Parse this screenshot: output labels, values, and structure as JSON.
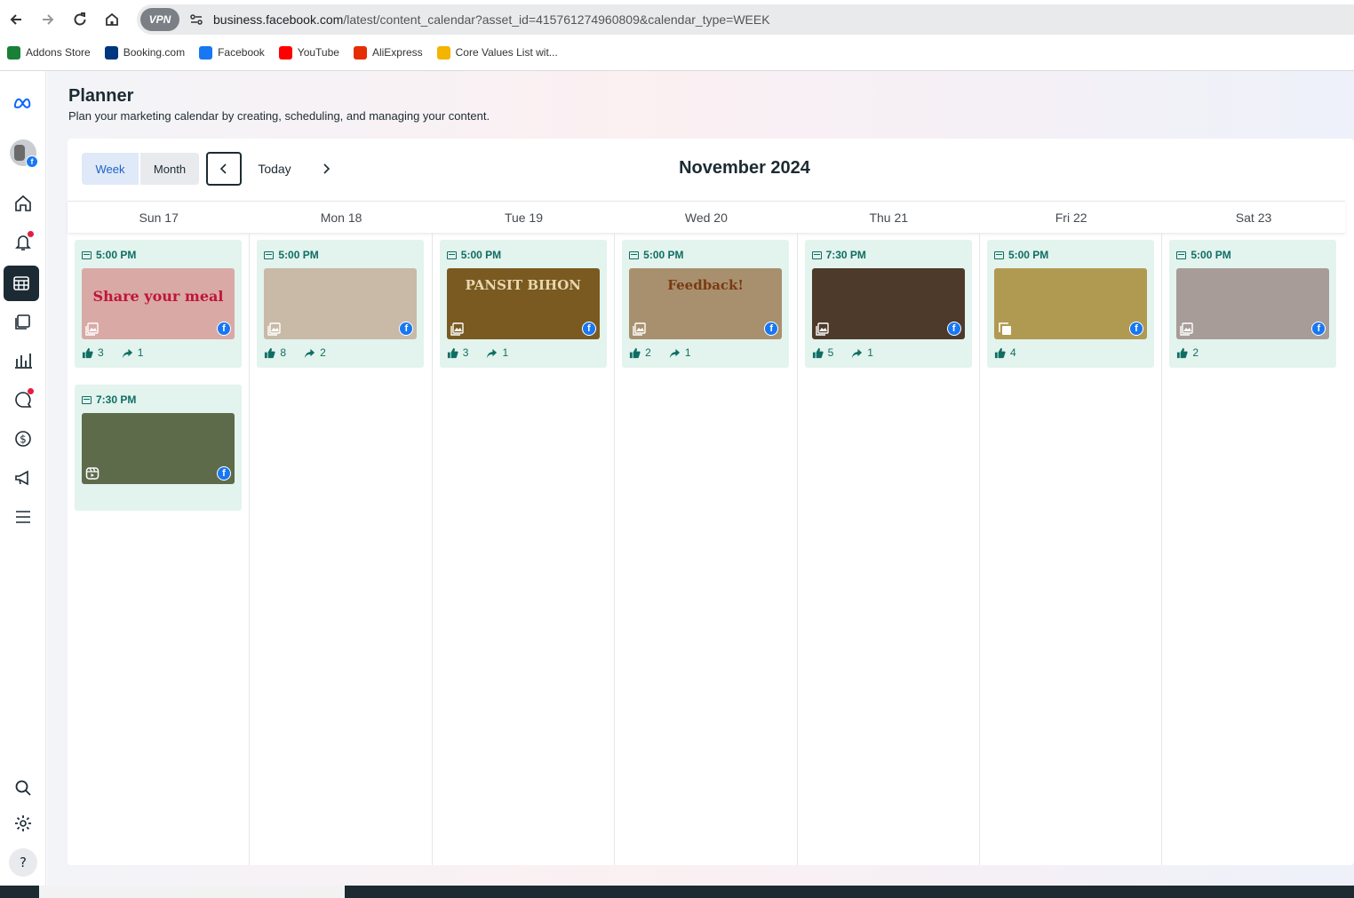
{
  "browser": {
    "vpn_label": "VPN",
    "url_domain": "business.facebook.com",
    "url_path": "/latest/content_calendar?asset_id=415761274960809&calendar_type=WEEK",
    "bookmarks": [
      {
        "label": "Addons Store",
        "color": "#1a7f37"
      },
      {
        "label": "Booking.com",
        "color": "#003580"
      },
      {
        "label": "Facebook",
        "color": "#1877f2"
      },
      {
        "label": "YouTube",
        "color": "#ff0000"
      },
      {
        "label": "AliExpress",
        "color": "#e62e04"
      },
      {
        "label": "Core Values List wit...",
        "color": "#f4b400"
      }
    ]
  },
  "sidebar": {
    "items": [
      "meta-logo-icon",
      "account-avatar",
      "home-icon",
      "notifications-icon",
      "planner-icon",
      "content-icon",
      "insights-icon",
      "inbox-icon",
      "monetization-icon",
      "ads-icon",
      "menu-icon",
      "search-icon",
      "settings-icon",
      "help-icon"
    ]
  },
  "header": {
    "title": "Planner",
    "subtitle": "Plan your marketing calendar by creating, scheduling, and managing your content."
  },
  "toolbar": {
    "week_label": "Week",
    "month_label": "Month",
    "today_label": "Today",
    "month_title": "November 2024"
  },
  "days": [
    "Sun 17",
    "Mon 18",
    "Tue 19",
    "Wed 20",
    "Thu 21",
    "Fri 22",
    "Sat 23"
  ],
  "posts": [
    {
      "day": 0,
      "time": "5:00 PM",
      "likes": "3",
      "shares": "1",
      "type": "photo",
      "thumb_text": "Share your meal",
      "bg": "#d9a9a6",
      "fg": "#c0143c"
    },
    {
      "day": 0,
      "time": "7:30 PM",
      "likes": "",
      "shares": "",
      "type": "reel",
      "thumb_text": "",
      "bg": "#5e6b4b",
      "fg": "#ffffff"
    },
    {
      "day": 1,
      "time": "5:00 PM",
      "likes": "8",
      "shares": "2",
      "type": "photo",
      "thumb_text": "",
      "bg": "#c9b9a7",
      "fg": "#2e6b3a"
    },
    {
      "day": 2,
      "time": "5:00 PM",
      "likes": "3",
      "shares": "1",
      "type": "photo",
      "thumb_text": "PANSIT BIHON",
      "bg": "#7a5a20",
      "fg": "#e8d8b0"
    },
    {
      "day": 3,
      "time": "5:00 PM",
      "likes": "2",
      "shares": "1",
      "type": "photo",
      "thumb_text": "Feedback!",
      "bg": "#a8906e",
      "fg": "#7a3a12"
    },
    {
      "day": 4,
      "time": "7:30 PM",
      "likes": "5",
      "shares": "1",
      "type": "photo",
      "thumb_text": "",
      "bg": "#4e3a2a",
      "fg": "#ffffff"
    },
    {
      "day": 5,
      "time": "5:00 PM",
      "likes": "4",
      "shares": "",
      "type": "album",
      "thumb_text": "",
      "bg": "#b09a52",
      "fg": "#ffffff"
    },
    {
      "day": 6,
      "time": "5:00 PM",
      "likes": "2",
      "shares": "",
      "type": "photo",
      "thumb_text": "",
      "bg": "#a89c98",
      "fg": "#c23b2a"
    }
  ],
  "colors": {
    "accent": "#1d62c4",
    "post_bg": "#e3f3ee",
    "post_text": "#0f6e62",
    "facebook": "#1877f2"
  }
}
